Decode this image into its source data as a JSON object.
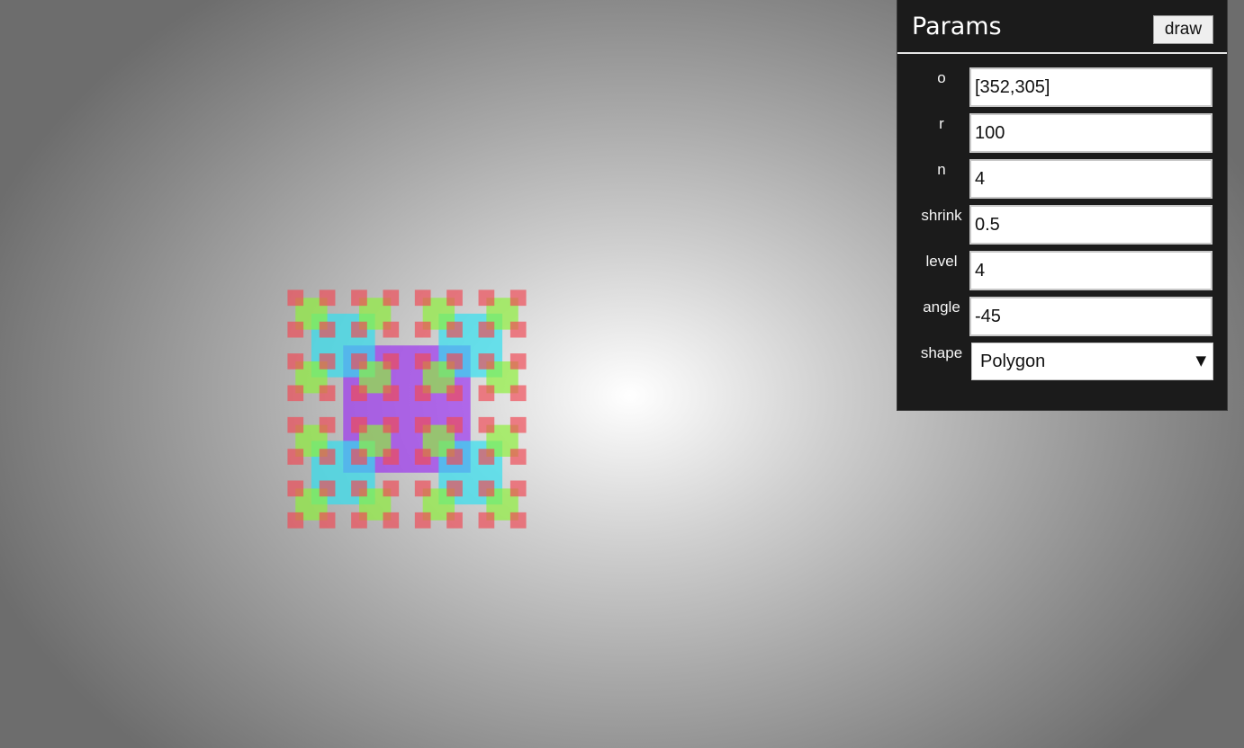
{
  "panel": {
    "title": "Params",
    "draw_label": "draw",
    "fields": [
      {
        "key": "o",
        "label": "o",
        "value": "[352,305]"
      },
      {
        "key": "r",
        "label": "r",
        "value": "100"
      },
      {
        "key": "n",
        "label": "n",
        "value": "4"
      },
      {
        "key": "shrink",
        "label": "shrink",
        "value": "0.5"
      },
      {
        "key": "level",
        "label": "level",
        "value": "4"
      },
      {
        "key": "angle",
        "label": "angle",
        "value": "-45"
      }
    ],
    "shape": {
      "label": "shape",
      "value": "Polygon",
      "arrow_icon": "triangle-down-icon"
    }
  },
  "fractal": {
    "o": [
      352,
      305
    ],
    "r": 100,
    "n": 4,
    "shrink": 0.5,
    "level": 4,
    "angle": -45,
    "shape": "Polygon",
    "level_colors": [
      "#9b30f0",
      "#2ee0f0",
      "#8ef03a",
      "#f04a55"
    ],
    "opacity": 0.68
  }
}
